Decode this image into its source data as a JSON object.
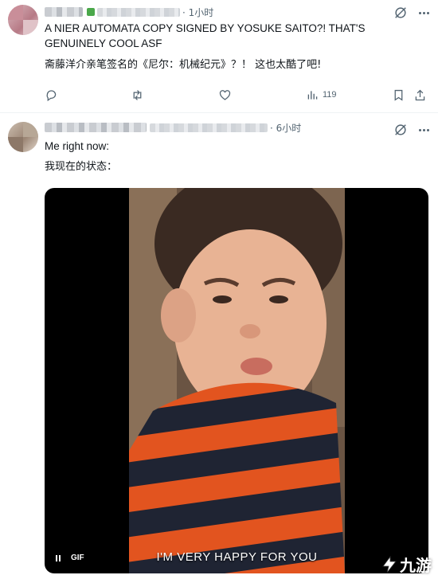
{
  "tweet1": {
    "time": "· 1小时",
    "text_en": "A NIER AUTOMATA COPY SIGNED BY YOSUKE SAITO?! THAT'S GENUINELY COOL ASF",
    "text_cn": "斋藤洋介亲笔签名的《尼尔：机械纪元》？！ 这也太酷了吧!",
    "actions": {
      "views": "119"
    }
  },
  "tweet2": {
    "time": "· 6小时",
    "text_en": "Me right now:",
    "text_cn": "我现在的状态：",
    "media": {
      "caption": "I'M VERY HAPPY FOR YOU",
      "gif_label": "GIF"
    }
  },
  "watermark": {
    "text": "九游"
  },
  "icons": [
    "grok-icon",
    "more-icon",
    "reply-icon",
    "retweet-icon",
    "like-icon",
    "views-icon",
    "bookmark-icon",
    "share-icon",
    "pause-icon"
  ],
  "colors": {
    "text": "#0f1419",
    "secondary": "#536471",
    "divider": "#eff3f4"
  }
}
